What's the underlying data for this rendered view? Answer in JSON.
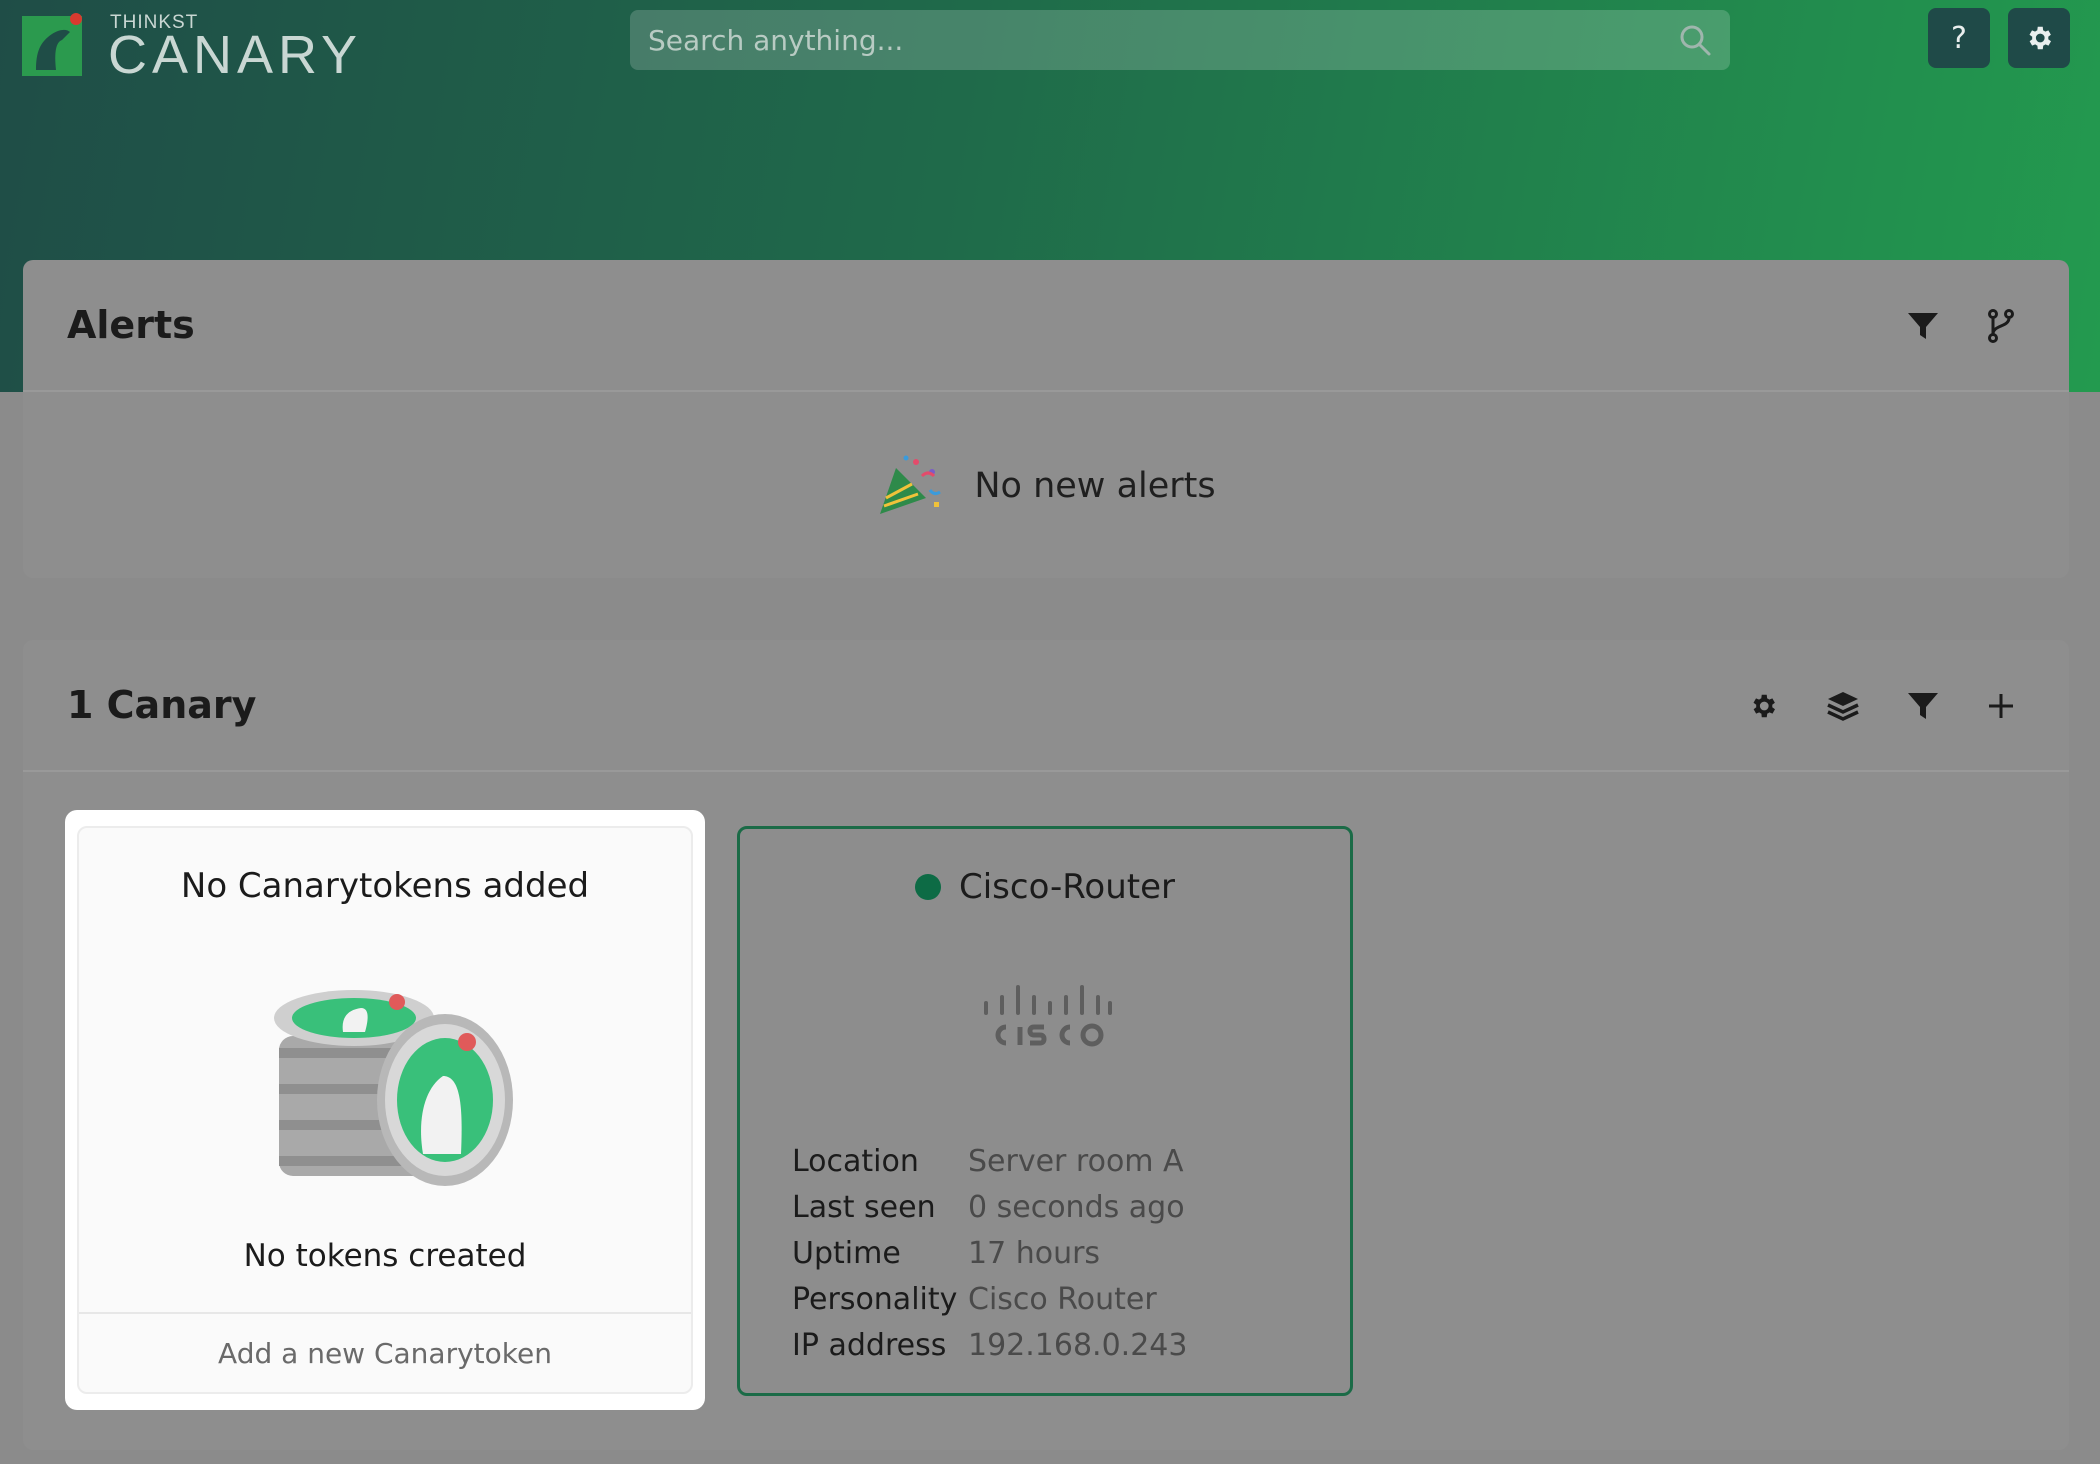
{
  "header": {
    "brand_small": "THINKST",
    "brand_big": "CANARY",
    "search_placeholder": "Search anything...",
    "help_label": "?"
  },
  "alerts": {
    "title": "Alerts",
    "empty_text": "No new alerts"
  },
  "canaries": {
    "title": "1 Canary",
    "token_card": {
      "title": "No Canarytokens added",
      "subtitle": "No tokens created",
      "action": "Add a new Canarytoken"
    },
    "device": {
      "name": "Cisco-Router",
      "status_color": "#0d6b45",
      "details": [
        {
          "key": "Location",
          "value": "Server room A"
        },
        {
          "key": "Last seen",
          "value": "0 seconds ago"
        },
        {
          "key": "Uptime",
          "value": "17 hours"
        },
        {
          "key": "Personality",
          "value": "Cisco Router"
        },
        {
          "key": "IP address",
          "value": "192.168.0.243"
        }
      ]
    }
  },
  "colors": {
    "accent": "#1b6b47",
    "hero_start": "#1f4d47",
    "hero_end": "#239a4f"
  }
}
